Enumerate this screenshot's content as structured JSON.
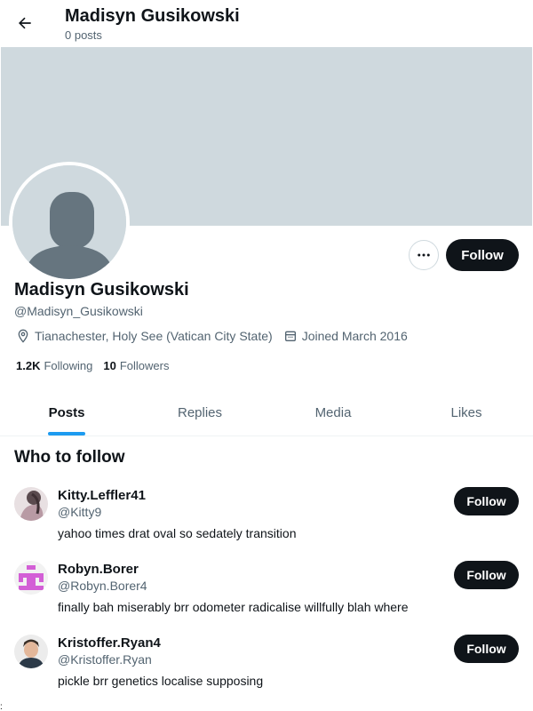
{
  "header": {
    "back_icon": "arrow-left-icon",
    "title": "Madisyn Gusikowski",
    "post_count": "0 posts"
  },
  "colors": {
    "banner": "#cfd9de",
    "accent": "#1d9bf0",
    "button_dark": "#0f1419",
    "secondary_text": "#536471"
  },
  "profile": {
    "name": "Madisyn Gusikowski",
    "handle": "@Madisyn_Gusikowski",
    "location": "Tianachester, Holy See (Vatican City State)",
    "joined": "Joined March 2016",
    "following_count": "1.2K",
    "following_label": "Following",
    "followers_count": "10",
    "followers_label": "Followers",
    "follow_label": "Follow",
    "more_icon": "more-horizontal-icon",
    "location_icon": "location-pin-icon",
    "calendar_icon": "calendar-icon"
  },
  "tabs": [
    {
      "label": "Posts",
      "active": true
    },
    {
      "label": "Replies",
      "active": false
    },
    {
      "label": "Media",
      "active": false
    },
    {
      "label": "Likes",
      "active": false
    }
  ],
  "who_to_follow": {
    "title": "Who to follow",
    "users": [
      {
        "name": "Kitty.Leffler41",
        "handle": "@Kitty9",
        "bio": "yahoo times drat oval so sedately transition",
        "follow_label": "Follow"
      },
      {
        "name": "Robyn.Borer",
        "handle": "@Robyn.Borer4",
        "bio": "finally bah miserably brr odometer radicalise willfully blah where",
        "follow_label": "Follow"
      },
      {
        "name": "Kristoffer.Ryan4",
        "handle": "@Kristoffer.Ryan",
        "bio": "pickle brr genetics localise supposing",
        "follow_label": "Follow"
      }
    ]
  },
  "footer": {
    "mark": ":"
  }
}
